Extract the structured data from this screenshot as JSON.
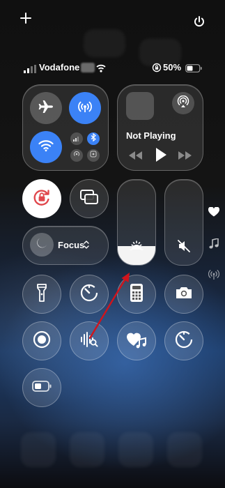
{
  "status_bar": {
    "carrier": "Vodafone",
    "battery_percent": "50%",
    "battery_level": 0.5
  },
  "media": {
    "now_playing": "Not Playing"
  },
  "focus": {
    "label": "Focus"
  },
  "sliders": {
    "brightness_level": 0.22,
    "volume_level": 0.0
  },
  "colors": {
    "accent_blue": "#3b82f6",
    "rotation_lock_red": "#e0474c"
  },
  "side_icons": [
    "heart-icon",
    "music-note-icon",
    "antenna-icon"
  ]
}
